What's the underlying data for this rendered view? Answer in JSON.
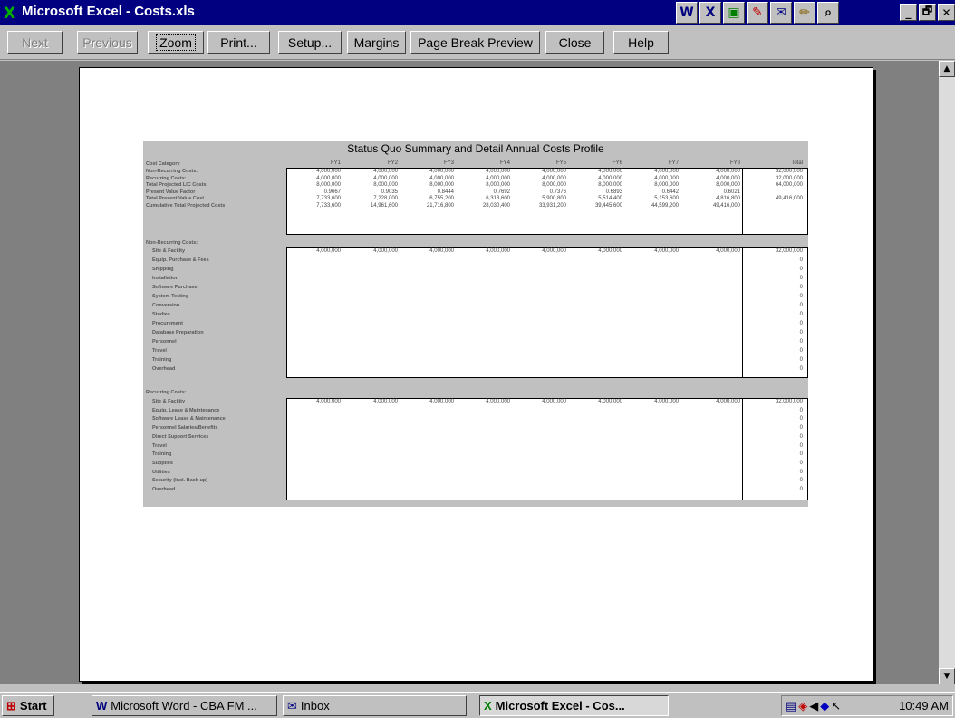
{
  "window": {
    "title": "Microsoft Excel - Costs.xls",
    "app_icon": "X",
    "tray_icons": [
      "W",
      "X",
      "▣",
      "✎",
      "✉",
      "✏",
      "⌕"
    ],
    "buttons": [
      "_",
      "🗗",
      "✕"
    ]
  },
  "toolbar": {
    "next": "Next",
    "previous": "Previous",
    "zoom": "Zoom",
    "print": "Print...",
    "setup": "Setup...",
    "margins": "Margins",
    "page_break": "Page Break Preview",
    "close": "Close",
    "help": "Help"
  },
  "sheet": {
    "title": "Status Quo Summary and Detail Annual Costs Profile",
    "column_header_label": "Cost Category",
    "years": [
      "FY1",
      "FY2",
      "FY3",
      "FY4",
      "FY5",
      "FY6",
      "FY7",
      "FY8"
    ],
    "total_label": "Total",
    "summary_rows": [
      {
        "label": "Non-Recurring Costs:",
        "values": [
          "4,000,000",
          "4,000,000",
          "4,000,000",
          "4,000,000",
          "4,000,000",
          "4,000,000",
          "4,000,000",
          "4,000,000"
        ],
        "total": "32,000,000"
      },
      {
        "label": "Recurring Costs:",
        "values": [
          "4,000,000",
          "4,000,000",
          "4,000,000",
          "4,000,000",
          "4,000,000",
          "4,000,000",
          "4,000,000",
          "4,000,000"
        ],
        "total": "32,000,000"
      },
      {
        "label": "Total Projected LIC Costs",
        "values": [
          "8,000,000",
          "8,000,000",
          "8,000,000",
          "8,000,000",
          "8,000,000",
          "8,000,000",
          "8,000,000",
          "8,000,000"
        ],
        "total": "64,000,000"
      },
      {
        "label": "Present Value Factor",
        "values": [
          "0.9667",
          "0.9035",
          "0.8444",
          "0.7692",
          "0.7376",
          "0.6893",
          "0.6442",
          "0.6021"
        ],
        "total": ""
      },
      {
        "label": "Total Present Value Cost",
        "values": [
          "7,733,600",
          "7,228,000",
          "6,755,200",
          "6,313,600",
          "5,900,800",
          "5,514,400",
          "5,153,600",
          "4,816,800"
        ],
        "total": "49,416,000"
      },
      {
        "label": "Cumulative Total Projected Costs",
        "values": [
          "7,733,600",
          "14,961,600",
          "21,716,800",
          "28,030,400",
          "33,931,200",
          "39,445,600",
          "44,599,200",
          "49,416,000"
        ],
        "total": ""
      }
    ],
    "nonrecurring": {
      "header": "Non-Recurring Costs:",
      "rows": [
        {
          "label": "Site & Facility",
          "values": [
            "4,000,000",
            "4,000,000",
            "4,000,000",
            "4,000,000",
            "4,000,000",
            "4,000,000",
            "4,000,000",
            "4,000,000"
          ],
          "total": "32,000,000"
        },
        {
          "label": "Equip. Purchase & Fees",
          "values": [],
          "total": "0"
        },
        {
          "label": "Shipping",
          "values": [],
          "total": "0"
        },
        {
          "label": "Installation",
          "values": [],
          "total": "0"
        },
        {
          "label": "Software Purchase",
          "values": [],
          "total": "0"
        },
        {
          "label": "System Testing",
          "values": [],
          "total": "0"
        },
        {
          "label": "Conversion",
          "values": [],
          "total": "0"
        },
        {
          "label": "Studies",
          "values": [],
          "total": "0"
        },
        {
          "label": "Procurement",
          "values": [],
          "total": "0"
        },
        {
          "label": "Database Preparation",
          "values": [],
          "total": "0"
        },
        {
          "label": "Personnel",
          "values": [],
          "total": "0"
        },
        {
          "label": "Travel",
          "values": [],
          "total": "0"
        },
        {
          "label": "Training",
          "values": [],
          "total": "0"
        },
        {
          "label": "Overhead",
          "values": [],
          "total": "0"
        }
      ]
    },
    "recurring": {
      "header": "Recurring Costs:",
      "rows": [
        {
          "label": "Site & Facility",
          "values": [
            "4,000,000",
            "4,000,000",
            "4,000,000",
            "4,000,000",
            "4,000,000",
            "4,000,000",
            "4,000,000",
            "4,000,000"
          ],
          "total": "32,000,000"
        },
        {
          "label": "Equip. Lease & Maintenance",
          "values": [],
          "total": "0"
        },
        {
          "label": "Software Lease & Maintenance",
          "values": [],
          "total": "0"
        },
        {
          "label": "Personnel Salaries/Benefits",
          "values": [],
          "total": "0"
        },
        {
          "label": "Direct Support Services",
          "values": [],
          "total": "0"
        },
        {
          "label": "Travel",
          "values": [],
          "total": "0"
        },
        {
          "label": "Training",
          "values": [],
          "total": "0"
        },
        {
          "label": "Supplies",
          "values": [],
          "total": "0"
        },
        {
          "label": "Utilities",
          "values": [],
          "total": "0"
        },
        {
          "label": "Security (Incl. Back-up)",
          "values": [],
          "total": "0"
        },
        {
          "label": "Overhead",
          "values": [],
          "total": "0"
        }
      ]
    }
  },
  "taskbar": {
    "start": "Start",
    "tasks": [
      {
        "icon": "W",
        "label": "Microsoft Word - CBA FM ..."
      },
      {
        "icon": "✉",
        "label": "Inbox"
      },
      {
        "icon": "X",
        "label": "Microsoft Excel - Cos..."
      }
    ],
    "clock": "10:49 AM"
  }
}
